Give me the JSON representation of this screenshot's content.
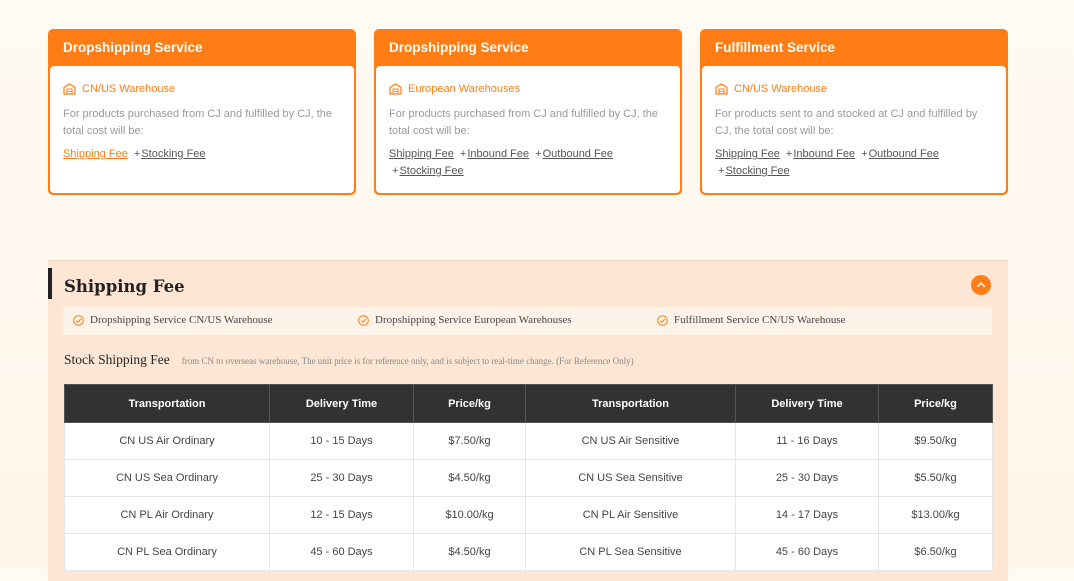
{
  "colors": {
    "accent": "#ff7d14",
    "table_header": "#323232",
    "section_bg": "#fde7d4"
  },
  "cards": [
    {
      "title": "Dropshipping Service",
      "warehouse": "CN/US Warehouse",
      "icon": "warehouse-icon",
      "description": "For products purchased from CJ and fulfilled by CJ, the total cost will be:",
      "fees": [
        "Shipping Fee",
        "Stocking Fee"
      ]
    },
    {
      "title": "Dropshipping Service",
      "warehouse": "European Warehouses",
      "icon": "warehouse-icon",
      "description": "For products purchased from CJ and fulfilled by CJ, the total cost will be:",
      "fees": [
        "Shipping Fee",
        "Inbound Fee",
        "Outbound Fee",
        "Stocking Fee"
      ]
    },
    {
      "title": "Fulfillment Service",
      "warehouse": "CN/US Warehouse",
      "icon": "warehouse-icon",
      "description": "For products sent to and stocked at CJ and fulfilled by CJ, the total cost will be:",
      "fees": [
        "Shipping Fee",
        "Inbound Fee",
        "Outbound Fee",
        "Stocking Fee"
      ]
    }
  ],
  "plus_sign": "+",
  "shipping": {
    "title": "Shipping Fee",
    "tabs": [
      "Dropshipping Service CN/US Warehouse",
      "Dropshipping Service European Warehouses",
      "Fulfillment Service CN/US Warehouse"
    ],
    "stock_title": "Stock Shipping Fee",
    "stock_note": "from CN to overseas warehouse, The unit price is for reference only, and is subject to real-time change. (For Reference Only)",
    "headers": [
      "Transportation",
      "Delivery Time",
      "Price/kg",
      "Transportation",
      "Delivery Time",
      "Price/kg"
    ],
    "rows": [
      [
        "CN US Air Ordinary",
        "10 - 15 Days",
        "$7.50/kg",
        "CN US Air Sensitive",
        "11 - 16 Days",
        "$9.50/kg"
      ],
      [
        "CN US Sea Ordinary",
        "25 - 30 Days",
        "$4.50/kg",
        "CN US Sea Sensitive",
        "25 - 30 Days",
        "$5.50/kg"
      ],
      [
        "CN PL Air Ordinary",
        "12 - 15 Days",
        "$10.00/kg",
        "CN PL Air Sensitive",
        "14 - 17 Days",
        "$13.00/kg"
      ],
      [
        "CN PL Sea Ordinary",
        "45 - 60 Days",
        "$4.50/kg",
        "CN PL Sea Sensitive",
        "45 - 60 Days",
        "$6.50/kg"
      ]
    ]
  }
}
